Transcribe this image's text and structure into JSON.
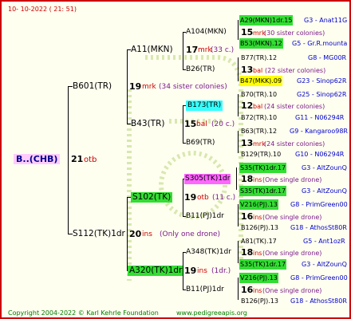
{
  "header": {
    "date": "10-  10-2022 ( 21: 51)"
  },
  "footer": {
    "copyright": "Copyright 2004-2022 © Karl Kehrle Foundation",
    "website": "www.pedigreeapis.org"
  },
  "colors": {
    "border": "#cc0000",
    "green_hl": "#33dd33",
    "cyan_hl": "#33ffff",
    "yellow_hl": "#ffff00",
    "magenta_hl": "#ff66ff",
    "root_hl": "#ffccff"
  },
  "root": {
    "label": "B..(CHB)",
    "count": "21",
    "count_code": "otb"
  },
  "gen1": [
    {
      "label": "B601(TR)",
      "count": "19",
      "code": "mrk",
      "note": "(34 sister colonies)"
    },
    {
      "label": "S112(TK)1dr",
      "count": "20",
      "code": "ins",
      "note": "(Only one drone)"
    }
  ],
  "gen2": [
    {
      "label": "A11(MKN)",
      "count": "17",
      "code": "mrk",
      "note": "(33 c.)"
    },
    {
      "label": "B43(TR)",
      "count": "15",
      "code": "bal",
      "note": "(20 c.)"
    },
    {
      "label": "S102(TK)",
      "count": "19",
      "code": "otb",
      "note": "(11 c.)"
    },
    {
      "label": "A320(TK)1dr",
      "count": "19",
      "code": "ins",
      "note": "(1dr.)"
    }
  ],
  "gen3": [
    {
      "label": "A104(MKN)",
      "count": "15",
      "code": "mrk",
      "note": "(30 sister colonies)"
    },
    {
      "label": "B26(TR)",
      "count": "13",
      "code": "bal",
      "note": "(22 sister colonies)"
    },
    {
      "label": "B173(TR)",
      "count": "12",
      "code": "bal",
      "note": "(24 sister colonies)"
    },
    {
      "label": "B69(TR)",
      "count": "13",
      "code": "mrk",
      "note": "(24 sister colonies)"
    },
    {
      "label": "S305(TK)1dr",
      "count": "18",
      "code": "ins",
      "note": "(One single drone)"
    },
    {
      "label": "B11(PJ)1dr",
      "count": "16",
      "code": "ins",
      "note": "(One single drone)"
    },
    {
      "label": "A348(TK)1dr",
      "count": "18",
      "code": "ins",
      "note": "(One single drone)"
    },
    {
      "label": "B11(PJ)1dr",
      "count": "16",
      "code": "ins",
      "note": "(One single drone)"
    }
  ],
  "gen4": [
    {
      "label": "A29(MKN)1dr.15",
      "extra": "G3 - Anat11G"
    },
    {
      "label": "B53(MKN).12",
      "extra": "G5 - Gr.R.mounta"
    },
    {
      "label": "B77(TR).12",
      "extra": "G8 - MG00R"
    },
    {
      "label": "B47(MKK).09",
      "extra": "G23 - Sinop62R"
    },
    {
      "label": "B70(TR).10",
      "extra": "G25 - Sinop62R"
    },
    {
      "label": "B72(TR).10",
      "extra": "G11 - N06294R"
    },
    {
      "label": "B63(TR).12",
      "extra": "G9 - Kangaroo98R"
    },
    {
      "label": "B129(TR).10",
      "extra": "G10 - N06294R"
    },
    {
      "label": "S35(TK)1dr.17",
      "extra": "G3 - AltZounQ"
    },
    {
      "label": "S35(TK)1dr.17",
      "extra": "G3 - AltZounQ"
    },
    {
      "label": "V216(PJ).13",
      "extra": "G8 - PrimGreen00"
    },
    {
      "label": "B126(PJ).13",
      "extra": "G18 - AthosSt80R"
    },
    {
      "label": "A81(TK).17",
      "extra": "G5 - Ant1ozR"
    },
    {
      "label": "S35(TK)1dr.17",
      "extra": "G3 - AltZounQ"
    },
    {
      "label": "V216(PJ).13",
      "extra": "G8 - PrimGreen00"
    },
    {
      "label": "B126(PJ).13",
      "extra": "G18 - AthosSt80R"
    }
  ]
}
